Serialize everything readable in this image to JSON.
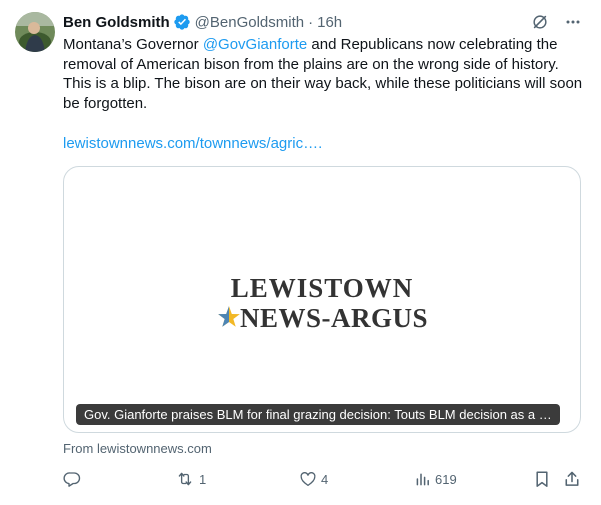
{
  "tweet": {
    "author_name": "Ben Goldsmith",
    "handle": "@BenGoldsmith",
    "separator": "·",
    "time": "16h",
    "text_before_mention": "Montana’s Governor ",
    "mention": "@GovGianforte",
    "text_after_mention": " and Republicans now celebrating the removal of American bison from the plains are on the wrong side of history. This is a blip. The bison are on their way back, while these politicians will soon be forgotten.",
    "link": "lewistownnews.com/townnews/agric…."
  },
  "card": {
    "logo_line1": "LEWISTOWN",
    "logo_line2": "NEWS-ARGUS",
    "caption": "Gov. Gianforte praises BLM for final grazing decision: Touts BLM decision as a …",
    "source": "From lewistownnews.com"
  },
  "actions": {
    "retweets": "1",
    "likes": "4",
    "views": "619"
  },
  "colors": {
    "accent": "#1d9bf0",
    "muted": "#536471",
    "text": "#0f1419",
    "border": "#cfd9de"
  },
  "icons": [
    "verified-badge-icon",
    "grok-icon",
    "more-icon",
    "reply-icon",
    "retweet-icon",
    "like-icon",
    "views-icon",
    "bookmark-icon",
    "share-icon"
  ]
}
